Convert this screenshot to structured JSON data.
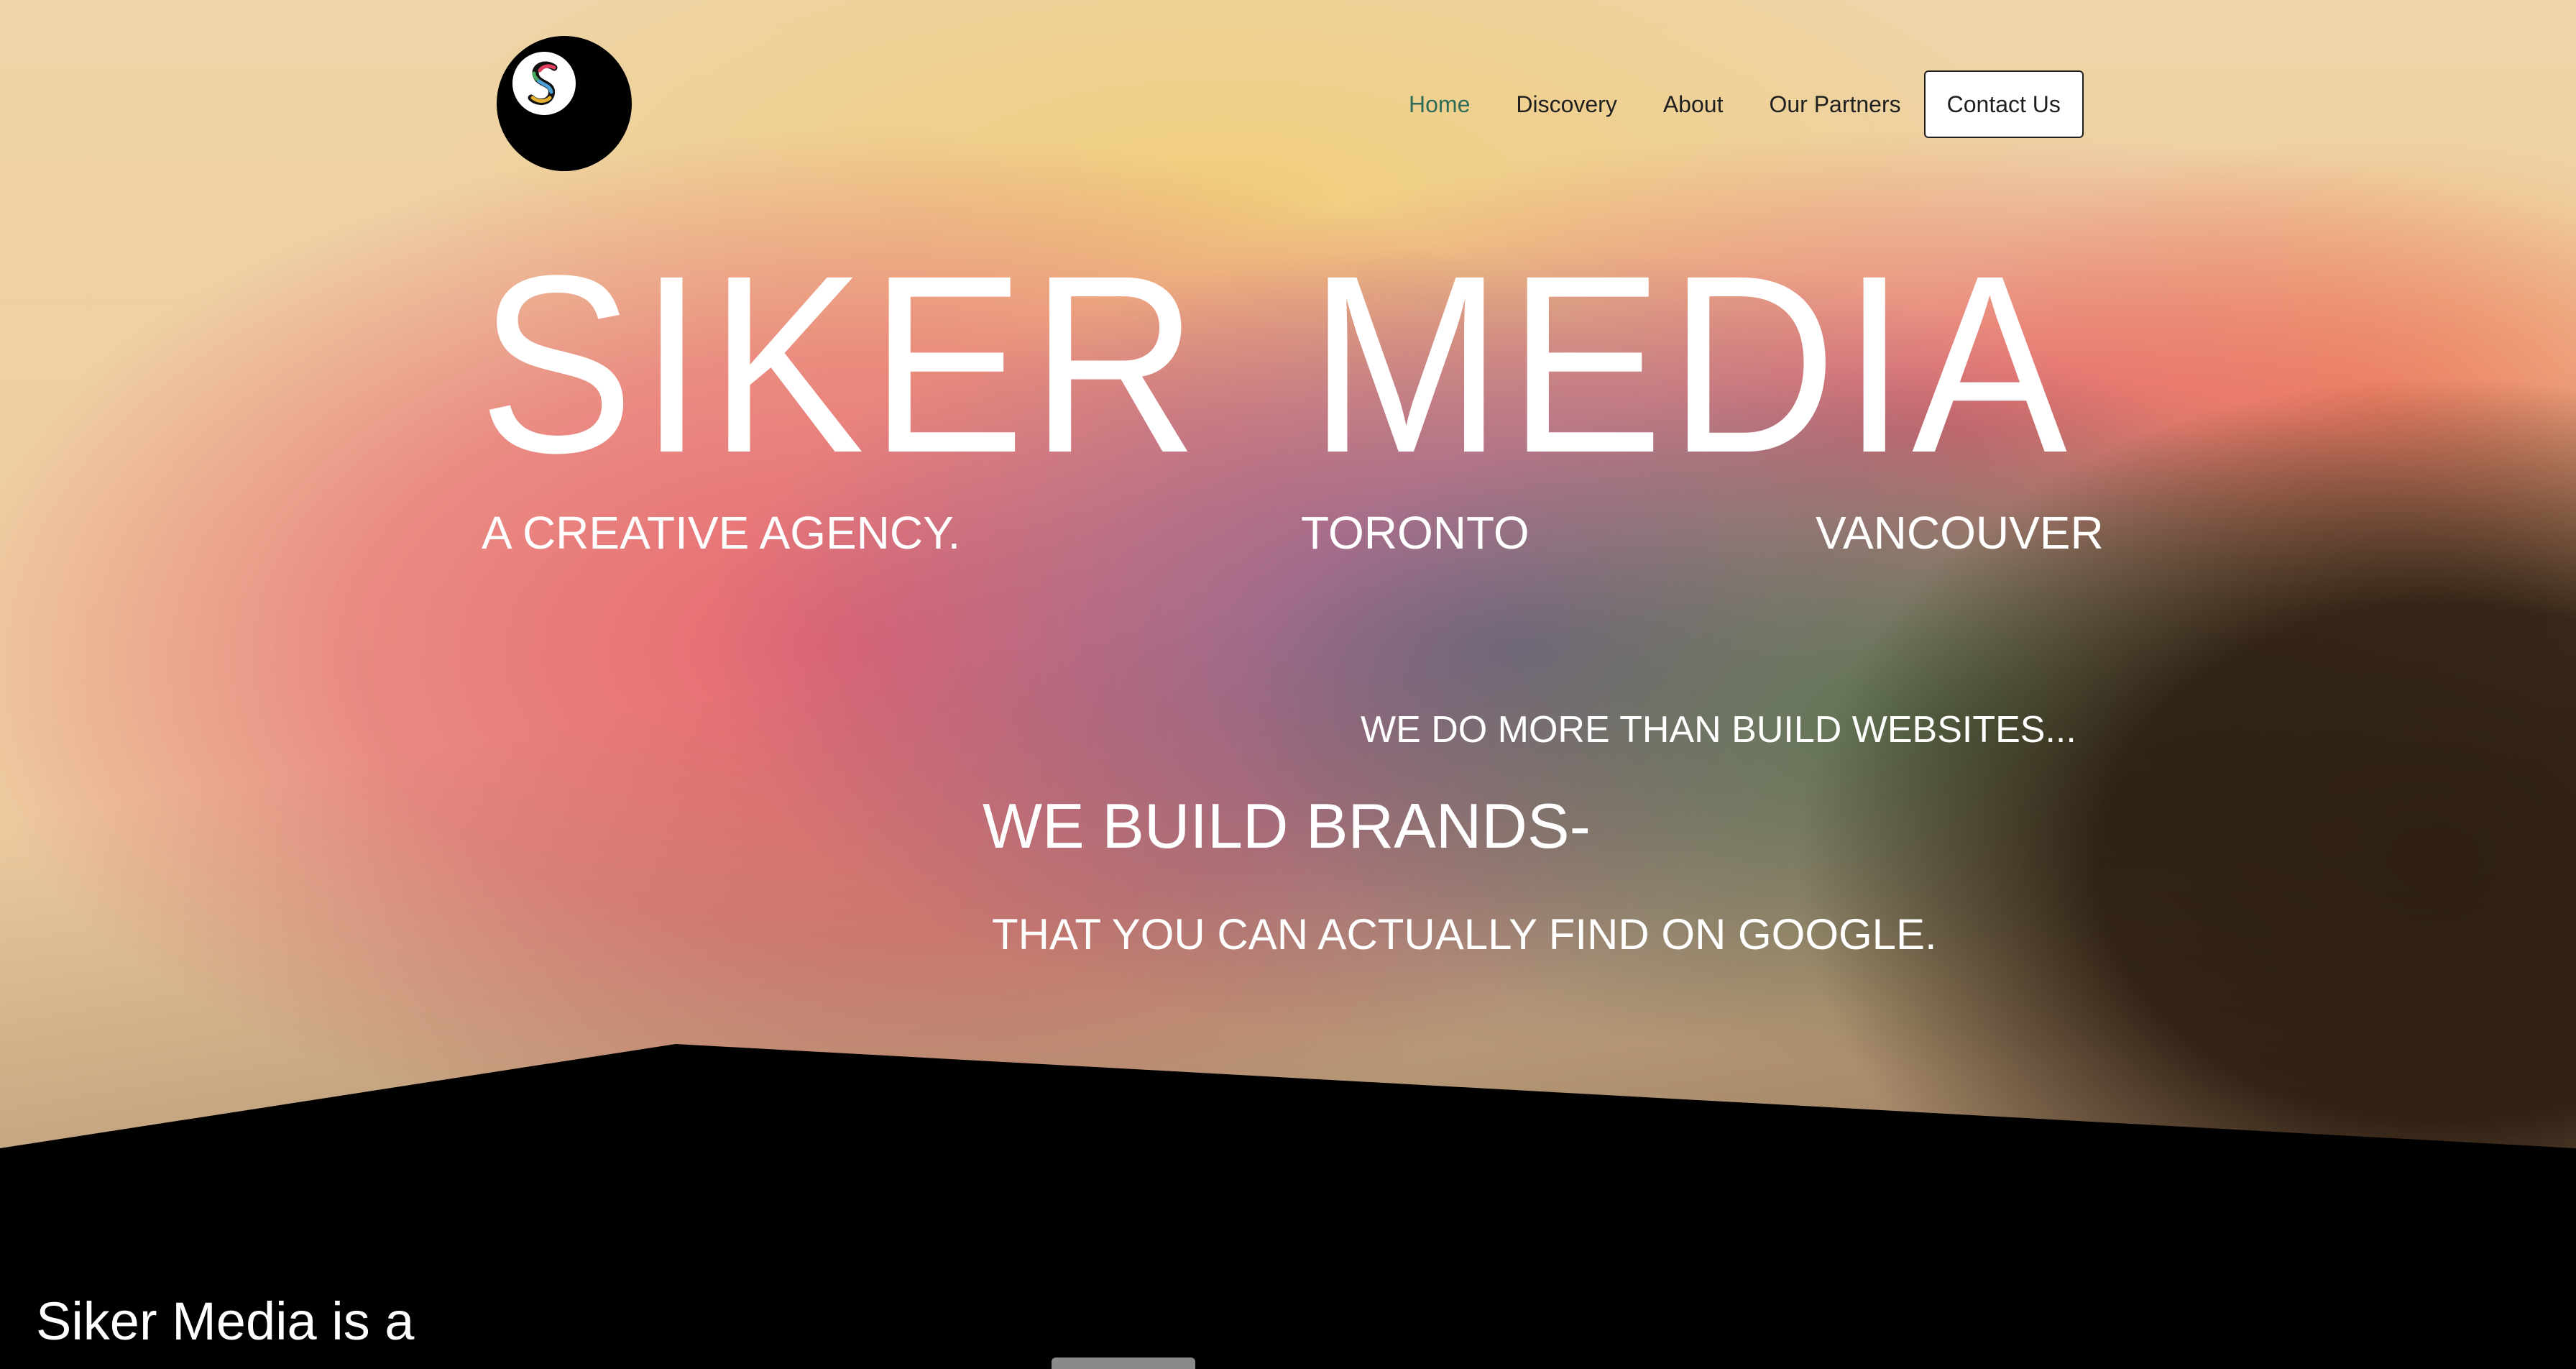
{
  "nav": {
    "items": [
      {
        "label": "Home",
        "active": true
      },
      {
        "label": "Discovery",
        "active": false
      },
      {
        "label": "About",
        "active": false
      },
      {
        "label": "Our Partners",
        "active": false
      }
    ],
    "contact_label": "Contact Us"
  },
  "logo": {
    "icon": "siker-s-logo-icon"
  },
  "hero": {
    "title_left": "SIKER",
    "title_right": "MEDIA",
    "tagline": "A CREATIVE AGENCY.",
    "city1": "TORONTO",
    "city2": "VANCOUVER",
    "line1": "WE DO MORE THAN BUILD WEBSITES...",
    "line2": "WE BUILD BRANDS-",
    "line3": "THAT YOU CAN ACTUALLY FIND ON GOOGLE."
  },
  "about": {
    "intro": "Siker Media is a"
  },
  "colors": {
    "nav_active": "#2e6b58",
    "nav_text": "#1f1f1f",
    "hero_text": "#ffffff",
    "section_bg": "#000000"
  }
}
